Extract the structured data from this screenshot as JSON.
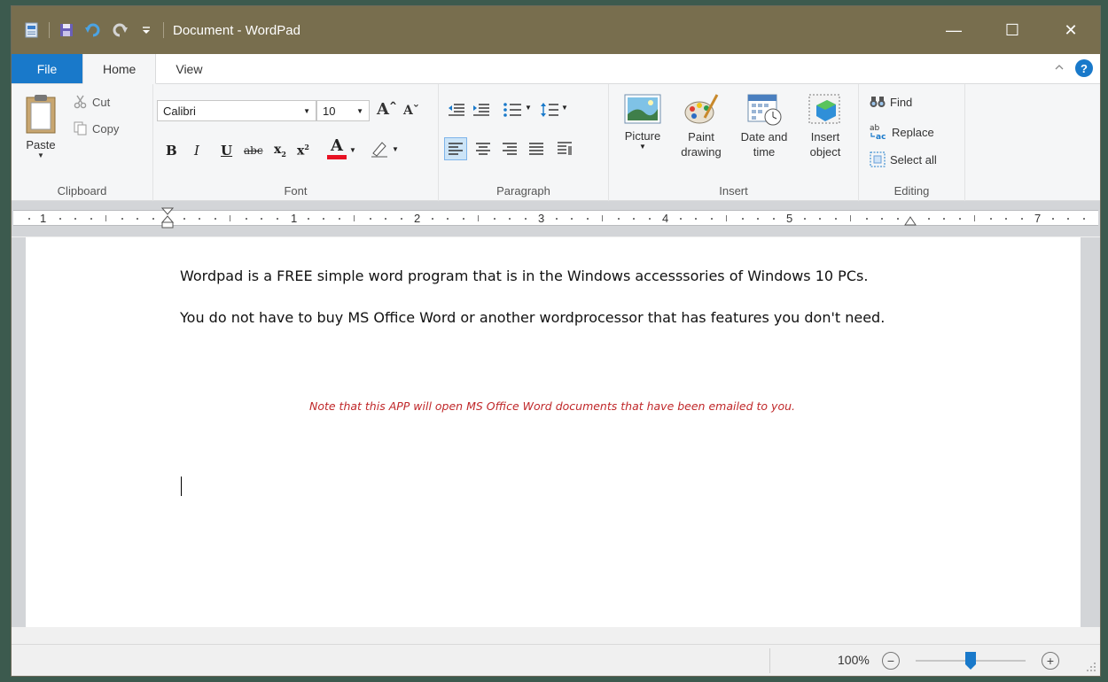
{
  "window": {
    "title": "Document - WordPad",
    "controls": {
      "minimize": "—",
      "maximize": "☐",
      "close": "✕"
    }
  },
  "tabs": {
    "file": "File",
    "home": "Home",
    "view": "View"
  },
  "clipboard": {
    "paste": "Paste",
    "cut": "Cut",
    "copy": "Copy",
    "group": "Clipboard"
  },
  "font": {
    "name": "Calibri",
    "size": "10",
    "group": "Font"
  },
  "paragraph": {
    "group": "Paragraph"
  },
  "insert": {
    "picture": "Picture",
    "paint_1": "Paint",
    "paint_2": "drawing",
    "datetime_1": "Date and",
    "datetime_2": "time",
    "object_1": "Insert",
    "object_2": "object",
    "group": "Insert"
  },
  "editing": {
    "find": "Find",
    "replace": "Replace",
    "select_all": "Select all",
    "group": "Editing"
  },
  "ruler": {
    "labels": [
      "1",
      "1",
      "2",
      "3",
      "4",
      "5",
      "7"
    ]
  },
  "document": {
    "para1": "Wordpad is a FREE simple word program that is in the Windows accesssories of Windows 10 PCs.",
    "para2": "You do not have to buy MS Office Word or another wordprocessor that has features you don't need.",
    "note": "Note that this APP will open MS Office Word documents that have been emailed to you."
  },
  "status": {
    "zoom": "100%",
    "zoom_level": 0.5
  },
  "colors": {
    "titlebar": "#786e4e",
    "file_tab": "#1979ca",
    "note": "#c0282a",
    "zoom_thumb": "#1979ca"
  }
}
